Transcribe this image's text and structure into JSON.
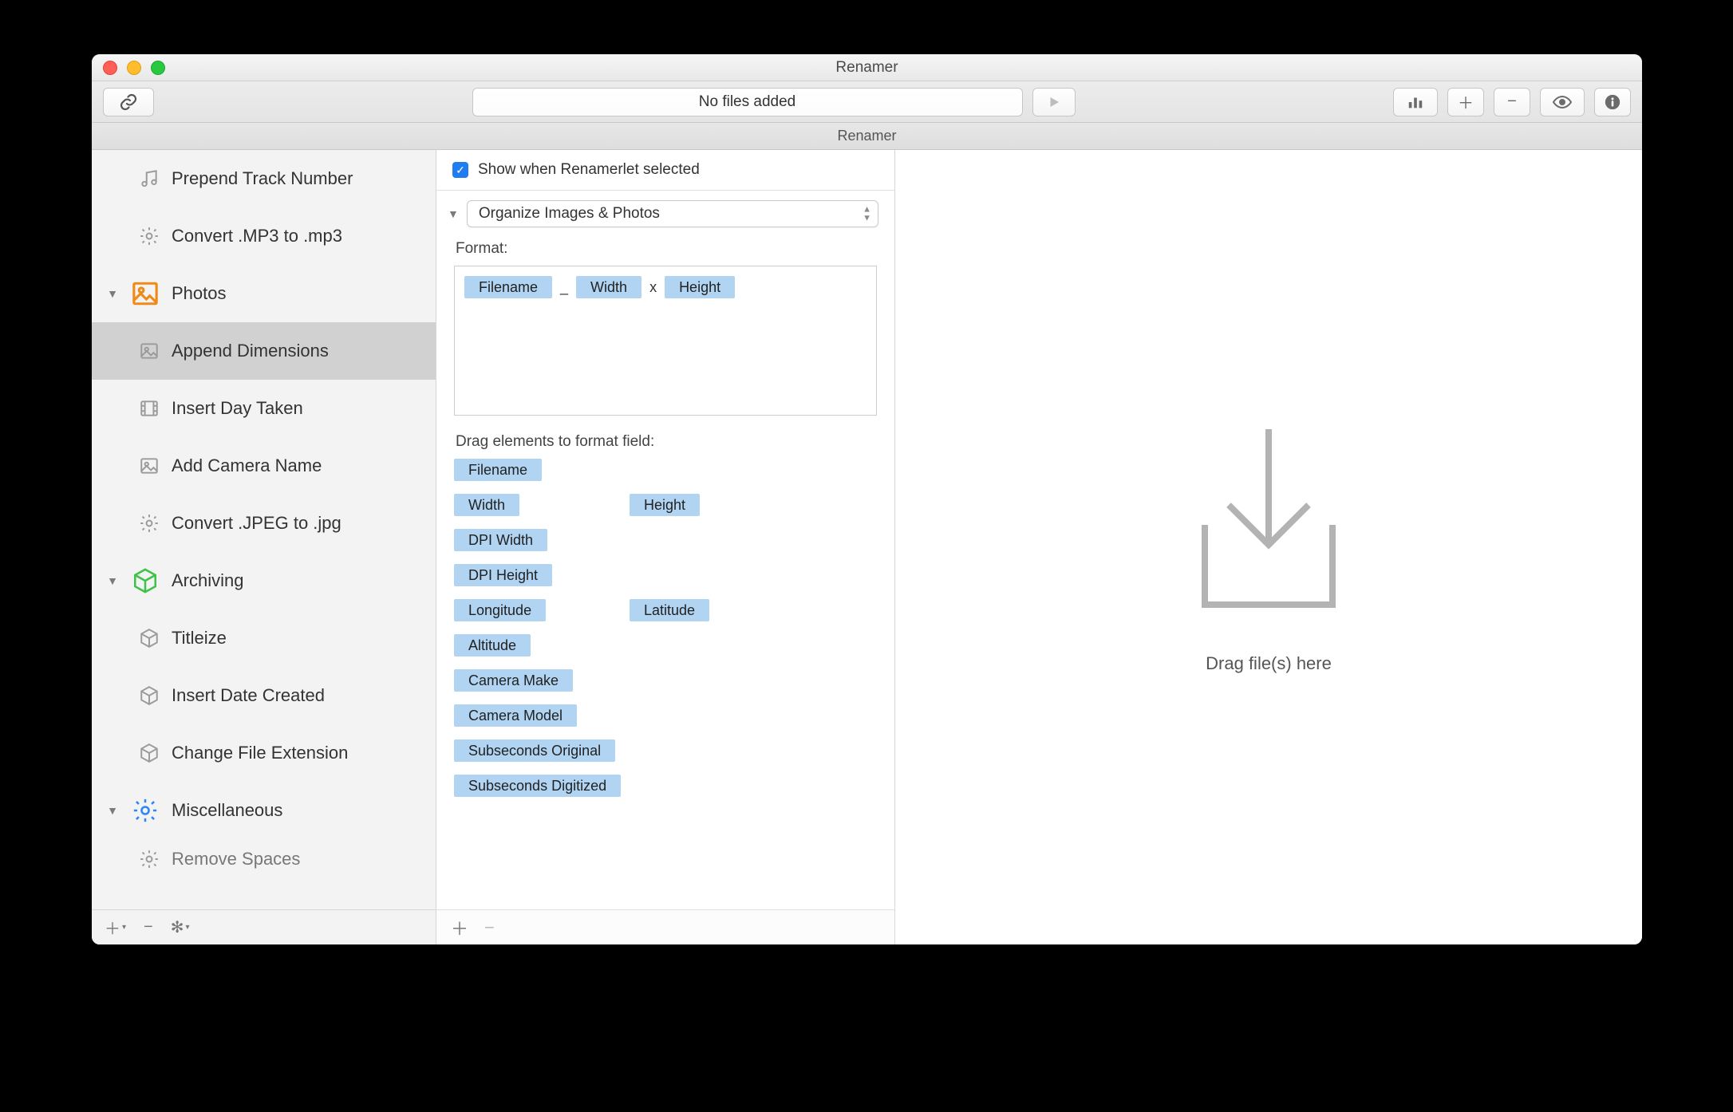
{
  "window": {
    "title": "Renamer",
    "subtitle": "Renamer"
  },
  "toolbar": {
    "fileStatus": "No files added"
  },
  "sidebar": {
    "items": [
      {
        "type": "item",
        "icon": "music",
        "label": "Prepend Track Number"
      },
      {
        "type": "item",
        "icon": "gear",
        "label": "Convert .MP3 to .mp3"
      },
      {
        "type": "group",
        "icon": "photo",
        "label": "Photos"
      },
      {
        "type": "item",
        "icon": "image",
        "label": "Append Dimensions",
        "selected": true
      },
      {
        "type": "item",
        "icon": "film",
        "label": "Insert Day Taken"
      },
      {
        "type": "item",
        "icon": "image",
        "label": "Add Camera Name"
      },
      {
        "type": "item",
        "icon": "gear",
        "label": "Convert .JPEG to .jpg"
      },
      {
        "type": "group",
        "icon": "cube-green",
        "label": "Archiving"
      },
      {
        "type": "item",
        "icon": "cube",
        "label": "Titleize"
      },
      {
        "type": "item",
        "icon": "cube",
        "label": "Insert Date Created"
      },
      {
        "type": "item",
        "icon": "cube",
        "label": "Change File Extension"
      },
      {
        "type": "group",
        "icon": "gear-blue",
        "label": "Miscellaneous"
      },
      {
        "type": "item-cut",
        "icon": "gear",
        "label": "Remove Spaces"
      }
    ]
  },
  "middle": {
    "checkboxLabel": "Show when Renamerlet selected",
    "presetName": "Organize Images & Photos",
    "formatLabel": "Format:",
    "formatTokens": [
      {
        "kind": "token",
        "text": "Filename"
      },
      {
        "kind": "sep",
        "text": "_"
      },
      {
        "kind": "token",
        "text": "Width"
      },
      {
        "kind": "sep",
        "text": "x"
      },
      {
        "kind": "token",
        "text": "Height"
      }
    ],
    "dragLabel": "Drag elements to format field:",
    "elements": [
      {
        "text": "Filename",
        "span": "full"
      },
      {
        "text": "Width",
        "span": "col1"
      },
      {
        "text": "Height",
        "span": "col2"
      },
      {
        "text": "DPI Width",
        "span": "full"
      },
      {
        "text": "DPI Height",
        "span": "full"
      },
      {
        "text": "Longitude",
        "span": "col1"
      },
      {
        "text": "Latitude",
        "span": "col2"
      },
      {
        "text": "Altitude",
        "span": "full"
      },
      {
        "text": "Camera Make",
        "span": "full"
      },
      {
        "text": "Camera Model",
        "span": "full"
      },
      {
        "text": "Subseconds Original",
        "span": "full"
      },
      {
        "text": "Subseconds Digitized",
        "span": "full"
      }
    ]
  },
  "drop": {
    "text": "Drag file(s) here"
  }
}
